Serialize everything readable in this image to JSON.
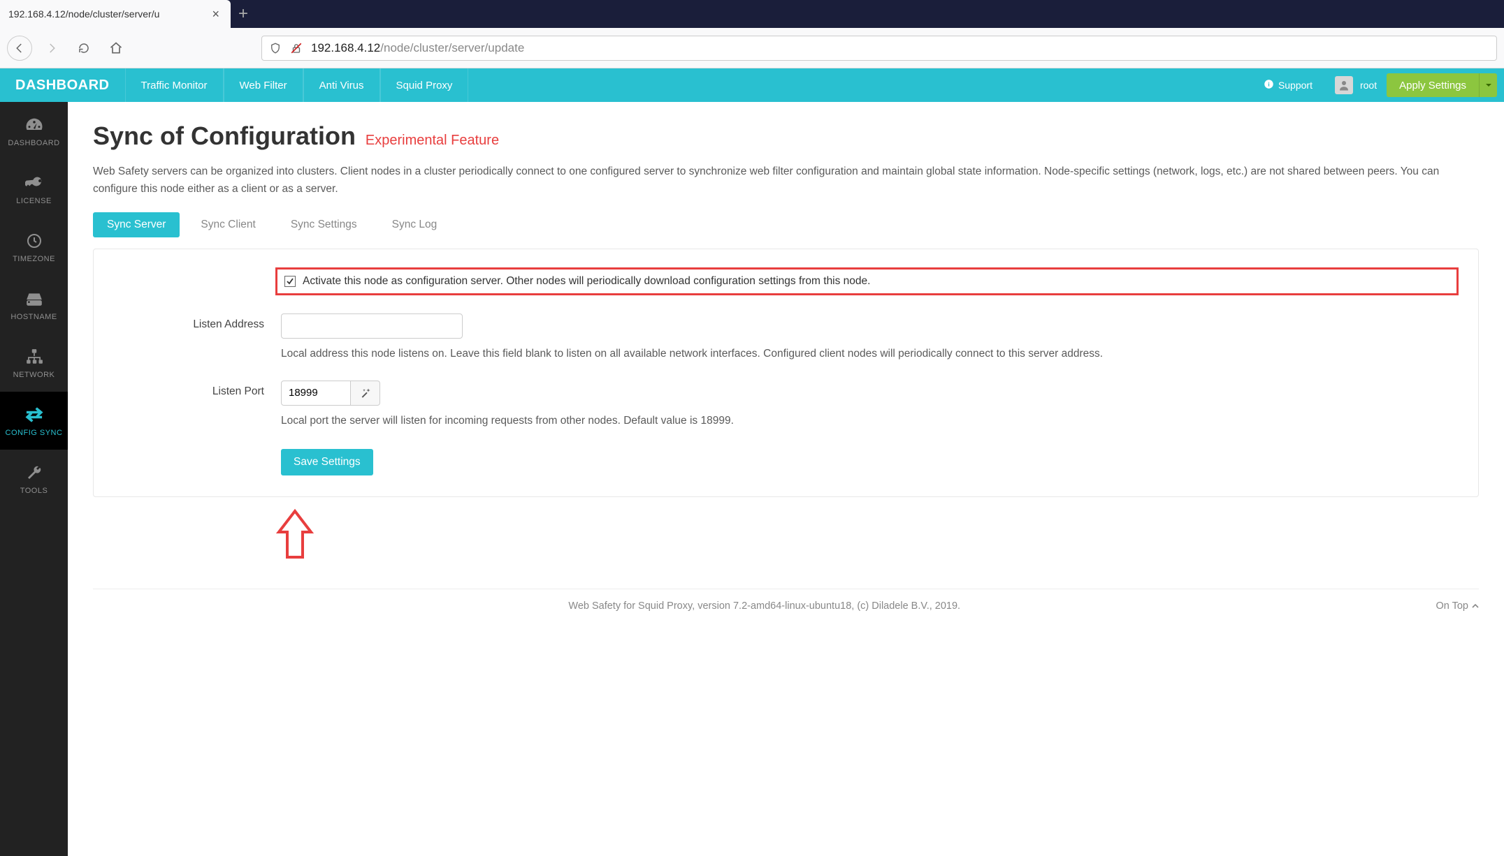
{
  "browser": {
    "tab_title": "192.168.4.12/node/cluster/server/u",
    "url_host": "192.168.4.12",
    "url_path": "/node/cluster/server/update"
  },
  "navbar": {
    "brand": "DASHBOARD",
    "items": [
      "Traffic Monitor",
      "Web Filter",
      "Anti Virus",
      "Squid Proxy"
    ],
    "support": "Support",
    "user": "root",
    "apply": "Apply Settings"
  },
  "sidebar": {
    "items": [
      {
        "label": "DASHBOARD",
        "icon": "gauge"
      },
      {
        "label": "LICENSE",
        "icon": "key"
      },
      {
        "label": "TIMEZONE",
        "icon": "clock"
      },
      {
        "label": "HOSTNAME",
        "icon": "drive"
      },
      {
        "label": "NETWORK",
        "icon": "sitemap"
      },
      {
        "label": "CONFIG SYNC",
        "icon": "exchange",
        "active": true
      },
      {
        "label": "TOOLS",
        "icon": "wrench"
      }
    ]
  },
  "page": {
    "title": "Sync of Configuration",
    "subtitle": "Experimental Feature",
    "description": "Web Safety servers can be organized into clusters. Client nodes in a cluster periodically connect to one configured server to synchronize web filter configuration and maintain global state information. Node-specific settings (network, logs, etc.) are not shared between peers. You can configure this node either as a client or as a server."
  },
  "tabs": {
    "items": [
      "Sync Server",
      "Sync Client",
      "Sync Settings",
      "Sync Log"
    ],
    "active": 0
  },
  "form": {
    "activate_label": "Activate this node as configuration server. Other nodes will periodically download configuration settings from this node.",
    "activate_checked": true,
    "listen_address": {
      "label": "Listen Address",
      "value": "",
      "help": "Local address this node listens on. Leave this field blank to listen on all available network interfaces. Configured client nodes will periodically connect to this server address."
    },
    "listen_port": {
      "label": "Listen Port",
      "value": "18999",
      "help": "Local port the server will listen for incoming requests from other nodes. Default value is 18999."
    },
    "save": "Save Settings"
  },
  "footer": {
    "text": "Web Safety for Squid Proxy, version 7.2-amd64-linux-ubuntu18, (c) Diladele B.V., 2019.",
    "ontop": "On Top"
  }
}
